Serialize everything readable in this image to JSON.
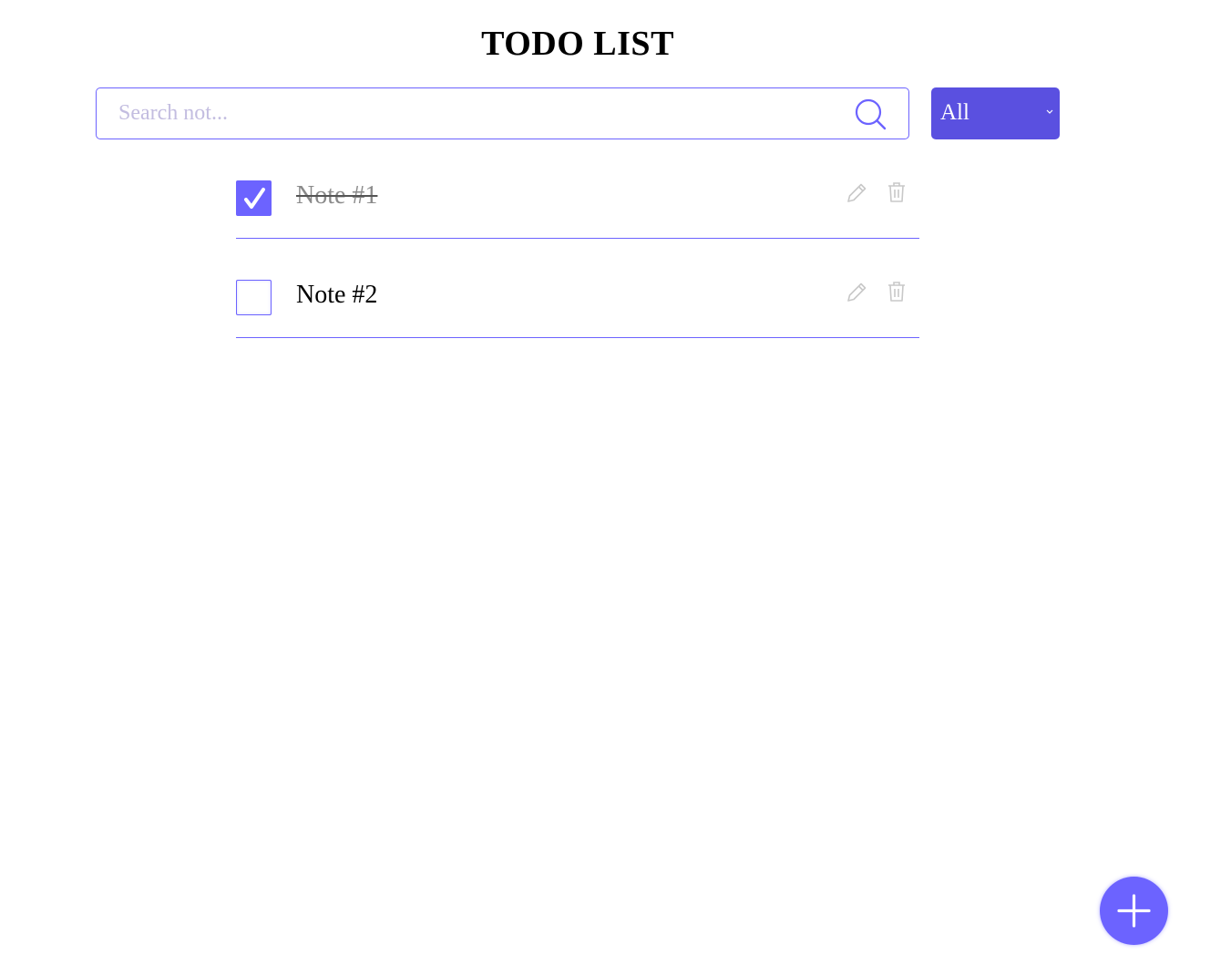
{
  "header": {
    "title": "TODO LIST"
  },
  "search": {
    "placeholder": "Search not...",
    "value": "",
    "icon": "search-icon"
  },
  "filter": {
    "selected": "All",
    "icon": "chevron-down-icon"
  },
  "todos": [
    {
      "text": "Note #1",
      "completed": true
    },
    {
      "text": "Note #2",
      "completed": false
    }
  ],
  "item_actions": {
    "edit_icon": "pencil-icon",
    "delete_icon": "trash-icon"
  },
  "add_button": {
    "icon": "plus-icon"
  },
  "colors": {
    "accent": "#6c63ff",
    "filter_bg": "#5a50e0",
    "placeholder": "#c3bde0",
    "done_text": "#8a8a8a",
    "action_icon": "#c8c8c8"
  }
}
